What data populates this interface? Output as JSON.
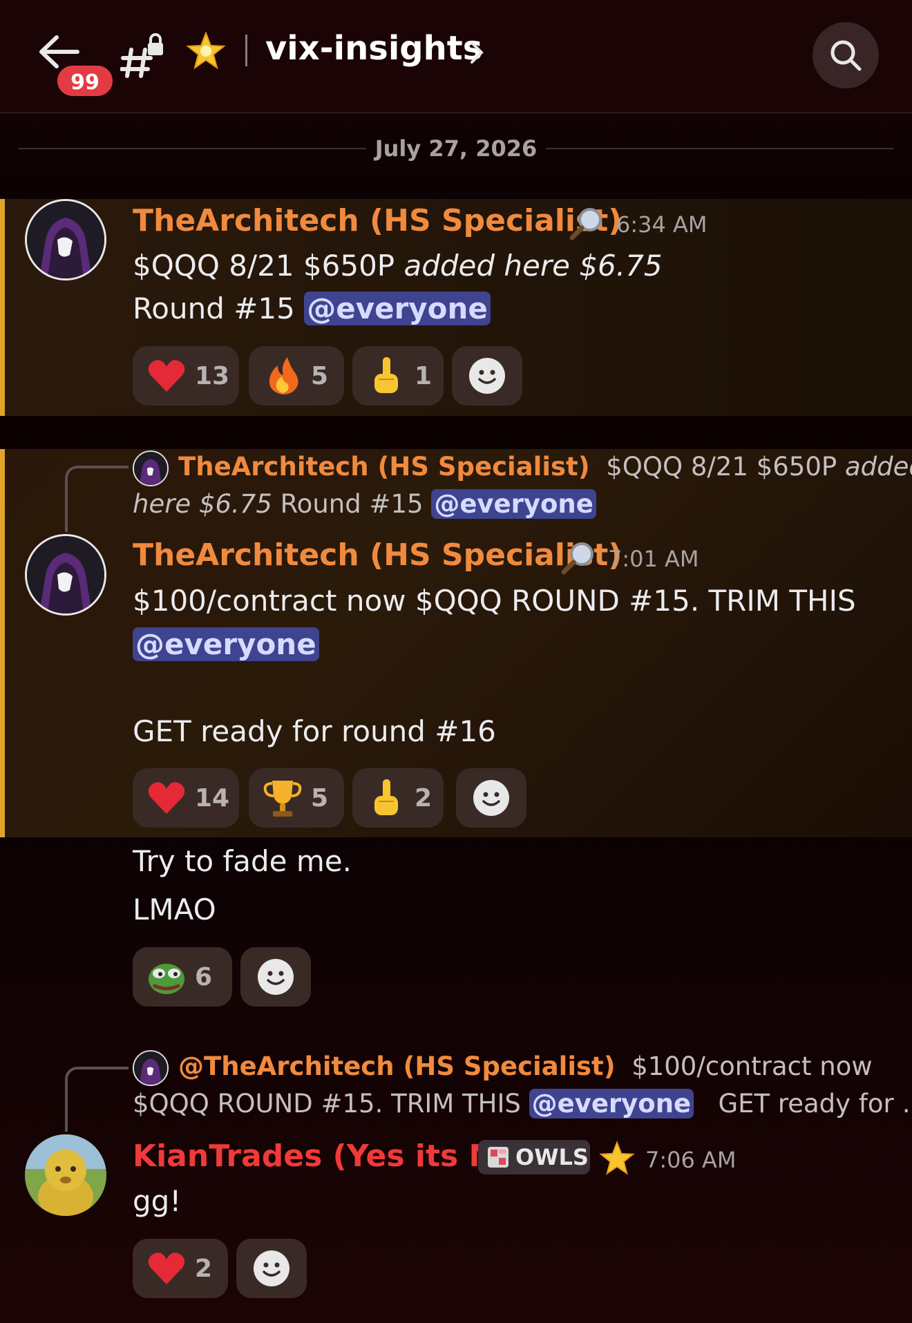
{
  "header": {
    "unread_badge": "99",
    "channel_name": "vix-insights"
  },
  "date_divider": "July 27, 2026",
  "messages": [
    {
      "author": "TheArchitech (HS Specialist)",
      "time": "6:34 AM",
      "line1_plain": "$QQQ 8/21 $650P ",
      "line1_italic": "added here $6.75",
      "line2_plain": "Round #15 ",
      "mention": "@everyone",
      "reactions": [
        {
          "emoji": "heart",
          "count": "13"
        },
        {
          "emoji": "fire",
          "count": "5"
        },
        {
          "emoji": "point-up",
          "count": "1"
        }
      ]
    },
    {
      "reply": {
        "author": "TheArchitech (HS Specialist)",
        "text_a": "$QQQ 8/21 $650P ",
        "text_a_italic": "added",
        "text_b_italic": "here $6.75",
        "text_b": " Round #15 ",
        "mention": "@everyone"
      },
      "author": "TheArchitech (HS Specialist)",
      "time": "7:01 AM",
      "line1": "$100/contract now $QQQ ROUND #15. TRIM THIS",
      "mention": "@everyone",
      "line3": "GET ready for round #16",
      "reactions": [
        {
          "emoji": "heart",
          "count": "14"
        },
        {
          "emoji": "trophy",
          "count": "5"
        },
        {
          "emoji": "point-up",
          "count": "2"
        }
      ]
    },
    {
      "line1": "Try to fade me.",
      "line2": "LMAO",
      "reactions": [
        {
          "emoji": "pepe",
          "count": "6"
        }
      ]
    },
    {
      "reply": {
        "author": "@TheArchitech (HS Specialist)",
        "text_a": "$100/contract now",
        "text_b": "$QQQ ROUND #15. TRIM THIS ",
        "mention": "@everyone",
        "text_c": "GET ready for …"
      },
      "author": "KianTrades (Yes its Me)",
      "tag": "OWLS",
      "time": "7:06 AM",
      "line1": "gg!",
      "reactions": [
        {
          "emoji": "heart",
          "count": "2"
        }
      ]
    }
  ],
  "colors": {
    "accent_bar": "#e0a42a",
    "username_orange": "#f08a3e",
    "username_red": "#f03a3a",
    "mention_bg": "#3f4490"
  }
}
